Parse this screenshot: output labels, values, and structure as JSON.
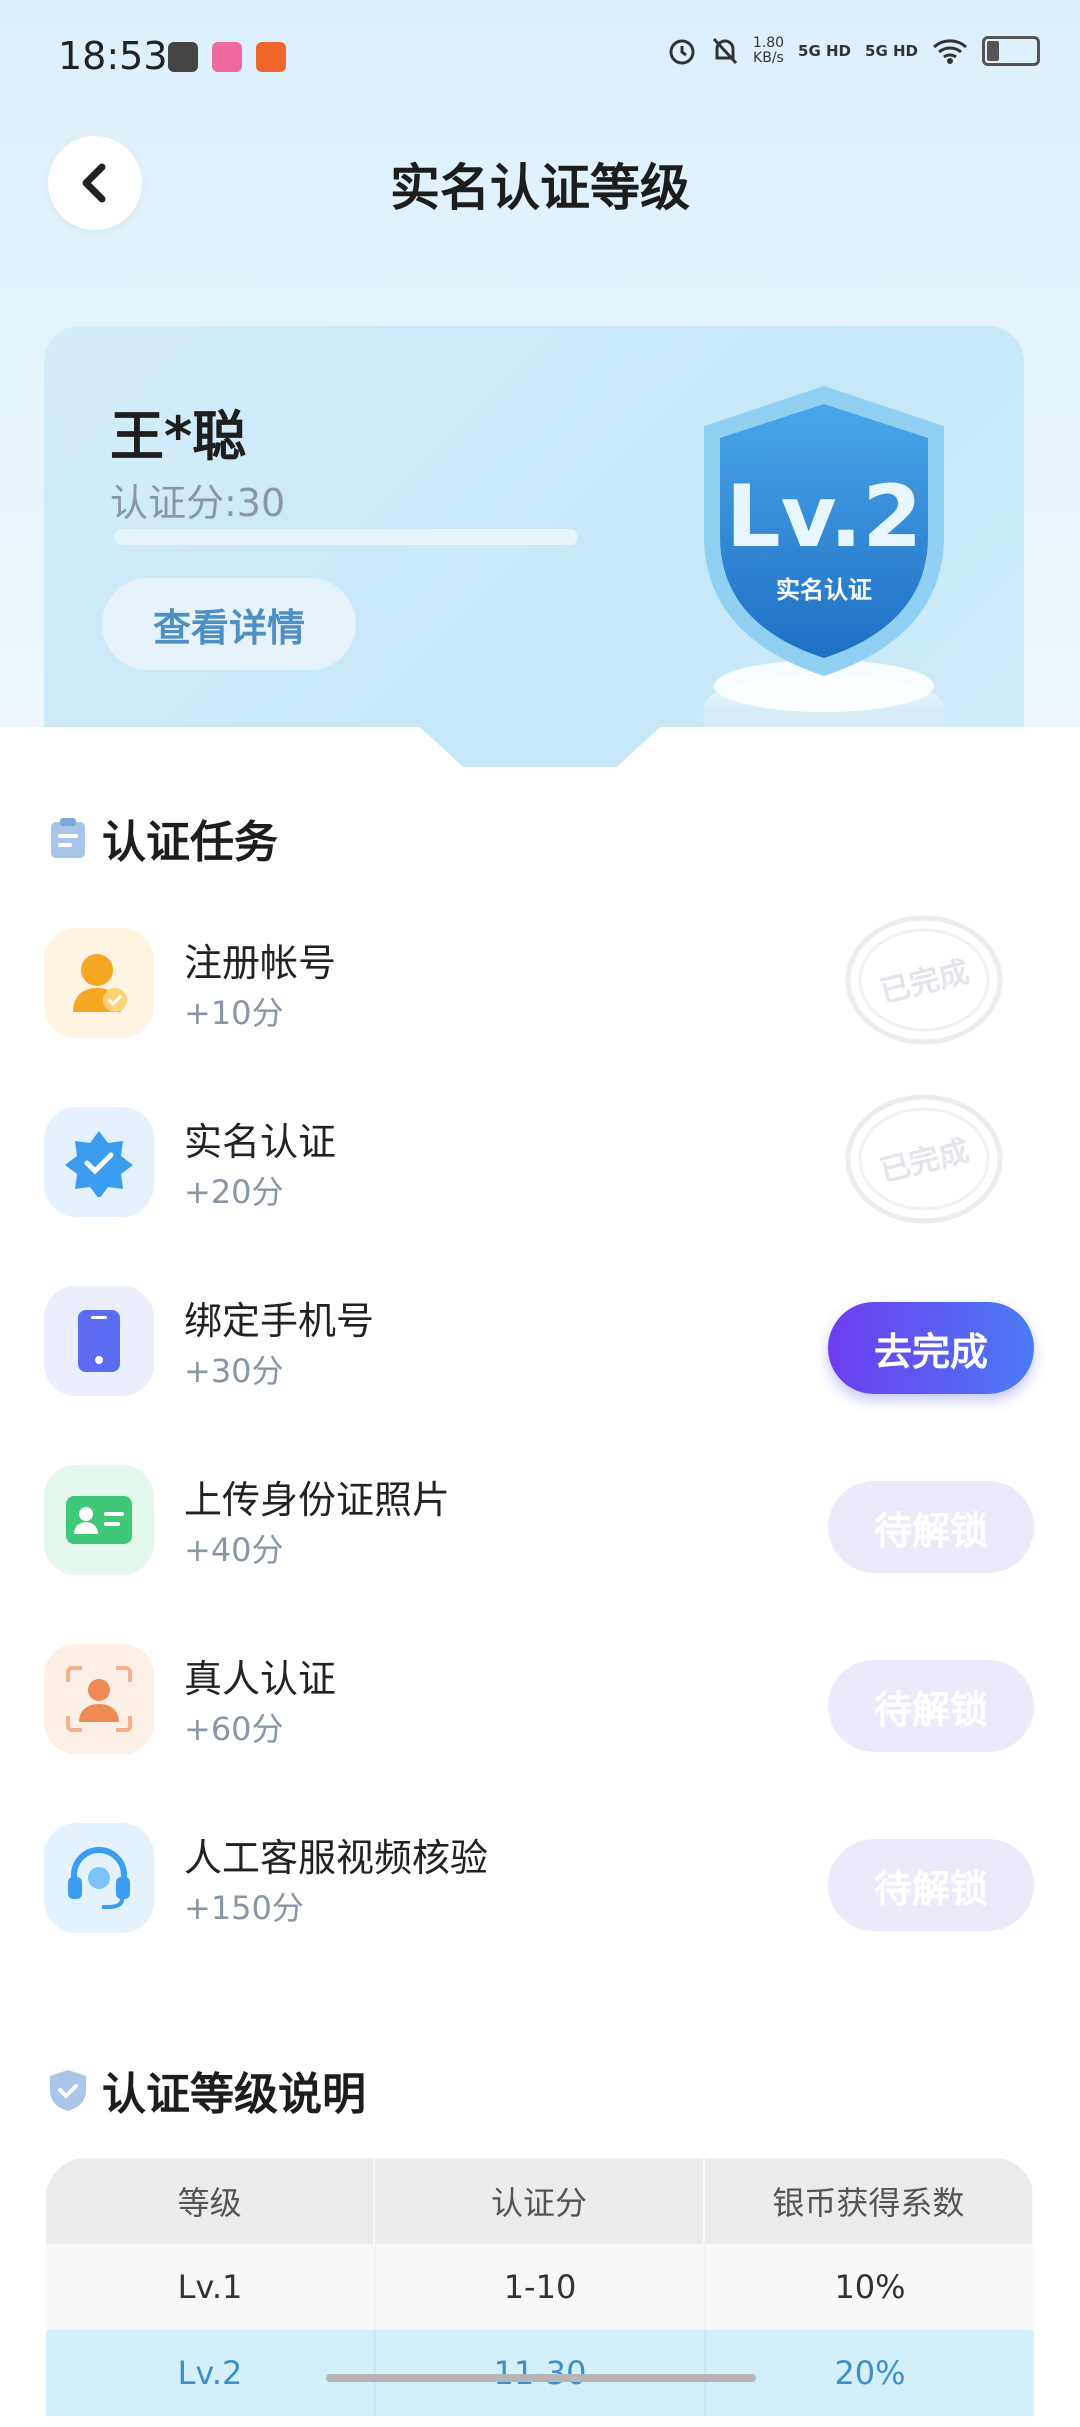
{
  "status_bar": {
    "time": "18:53",
    "net_speed_value": "1.80",
    "net_speed_unit": "KB/s",
    "signal1": "5G HD",
    "signal2": "5G HD"
  },
  "header": {
    "title": "实名认证等级",
    "back_icon": "chevron-left-icon"
  },
  "level_card": {
    "user_name": "王*聪",
    "score_text": "认证分:30",
    "details_button": "查看详情",
    "badge_level": "Lv.2",
    "badge_caption": "实名认证"
  },
  "tasks_section": {
    "title": "认证任务",
    "tasks": [
      {
        "name": "注册帐号",
        "points": "+10分",
        "status": "已完成",
        "icon": "user-check-icon",
        "icon_bg": "#fff3e2",
        "icon_color": "#f5a623"
      },
      {
        "name": "实名认证",
        "points": "+20分",
        "status": "已完成",
        "icon": "verified-star-icon",
        "icon_bg": "#e5f2fd",
        "icon_color": "#3b9df0"
      },
      {
        "name": "绑定手机号",
        "points": "+30分",
        "action": "去完成",
        "icon": "phone-icon",
        "icon_bg": "#ecedfd",
        "icon_color": "#5b6cf0"
      },
      {
        "name": "上传身份证照片",
        "points": "+40分",
        "action": "待解锁",
        "icon": "id-card-icon",
        "icon_bg": "#e4f7ec",
        "icon_color": "#3ec877"
      },
      {
        "name": "真人认证",
        "points": "+60分",
        "action": "待解锁",
        "icon": "face-scan-icon",
        "icon_bg": "#fdeee6",
        "icon_color": "#f08a55"
      },
      {
        "name": "人工客服视频核验",
        "points": "+150分",
        "action": "待解锁",
        "icon": "headset-icon",
        "icon_bg": "#e4f2fd",
        "icon_color": "#3b9df0"
      }
    ]
  },
  "levels_section": {
    "title": "认证等级说明",
    "columns": [
      "等级",
      "认证分",
      "银币获得系数"
    ],
    "rows": [
      [
        "Lv.1",
        "1-10",
        "10%"
      ],
      [
        "Lv.2",
        "11-30",
        "20%"
      ]
    ]
  },
  "colors": {
    "accent_gradient_start": "#6d3cf0",
    "accent_gradient_end": "#4b7bf5",
    "locked_button": "#ede9fb",
    "highlight_row": "#d3f0fa"
  }
}
